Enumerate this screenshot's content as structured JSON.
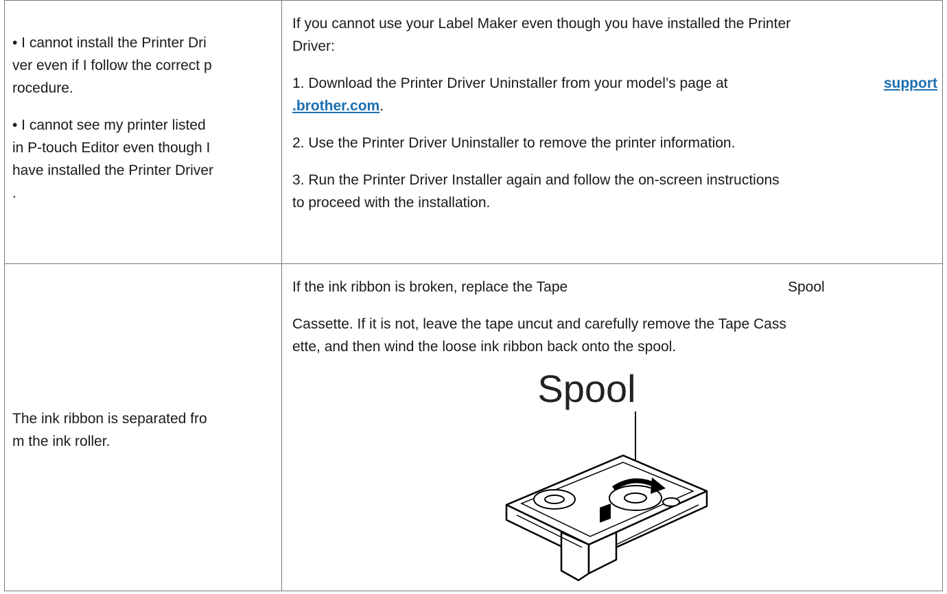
{
  "rows": [
    {
      "problem": [
        "• I cannot install the Printer Dri",
        "ver even if I follow the correct p",
        "rocedure.",
        "• I cannot see my printer listed",
        "in P-touch Editor even though I",
        "have installed the Printer Driver",
        "."
      ],
      "solution": {
        "intro": [
          "If you cannot use your Label Maker even though you have installed the Printer",
          "Driver:"
        ],
        "step1_prefix": "1.  Download the Printer Driver Uninstaller from your model’s page at",
        "step1_link_a": "support",
        "step1_link_b": ".brother.com",
        "step1_suffix": ".",
        "step2": "2.  Use the Printer Driver Uninstaller to remove the printer information.",
        "step3": [
          "3.  Run the Printer Driver Installer again and follow the on-screen instructions",
          "to proceed with the installation."
        ]
      }
    },
    {
      "problem": [
        "The ink ribbon is separated fro",
        "m the ink roller."
      ],
      "solution": {
        "line1": "If the ink ribbon is broken, replace the Tape",
        "line1_floating": "Spool",
        "line2": [
          "Cassette. If it is not, leave the tape uncut and carefully remove the Tape Cass",
          "ette, and then wind the loose ink ribbon back onto the spool."
        ],
        "figure_label": "Spool"
      }
    }
  ]
}
